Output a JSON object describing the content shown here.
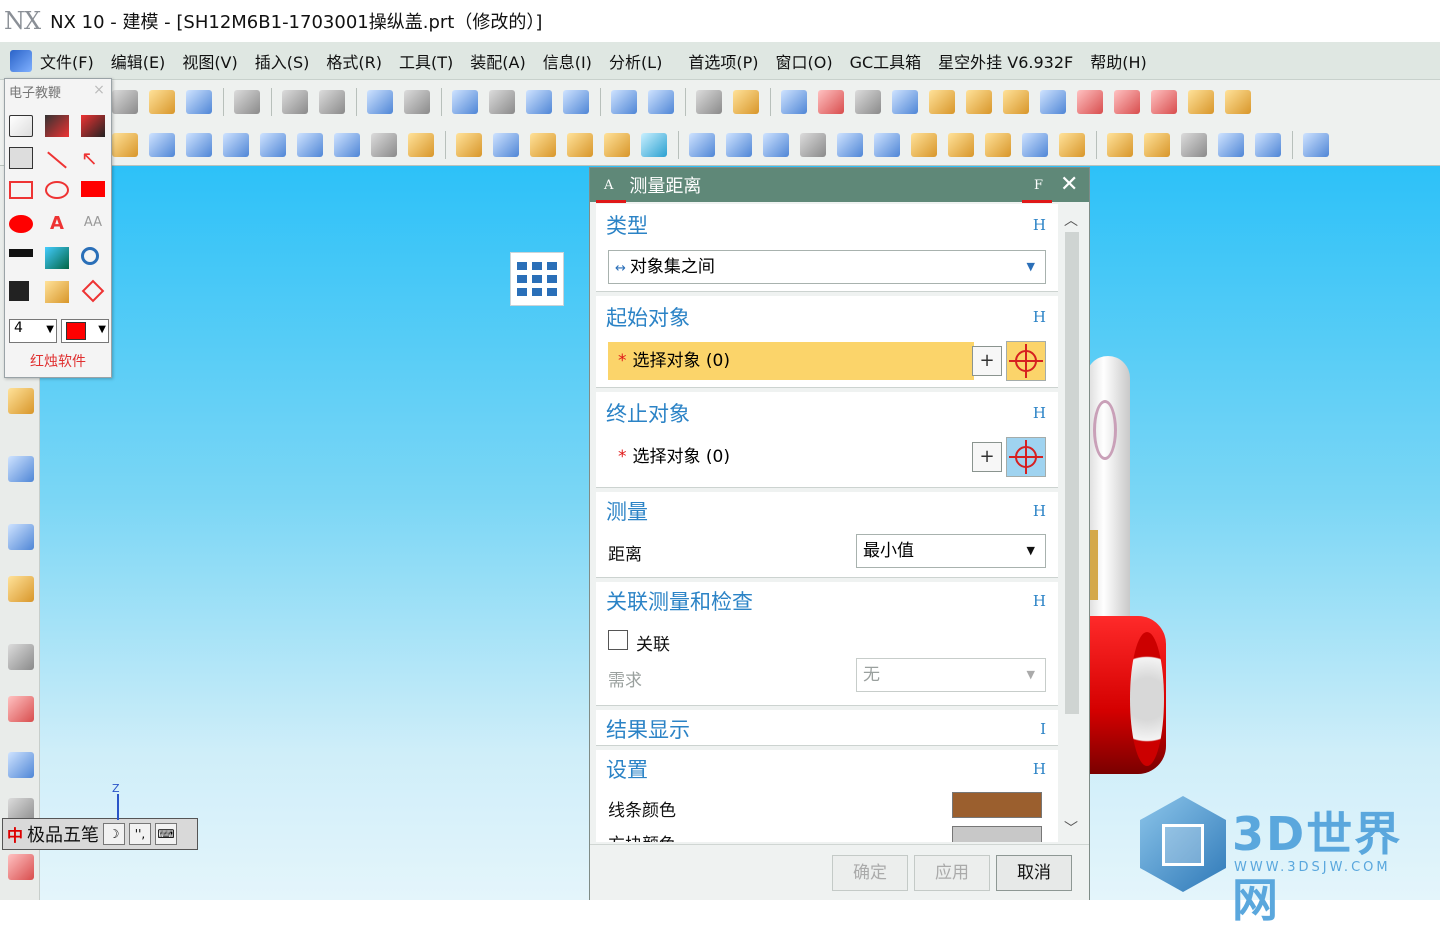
{
  "window": {
    "logo": "NX",
    "title": "NX 10 - 建模 - [SH12M6B1-1703001操纵盖.prt（修改的）]"
  },
  "menubar": {
    "items": [
      "文件(F)",
      "编辑(E)",
      "视图(V)",
      "插入(S)",
      "格式(R)",
      "工具(T)",
      "装配(A)",
      "信息(I)",
      "分析(L)",
      "首选项(P)",
      "窗口(O)",
      "GC工具箱",
      "星空外挂 V6.932F",
      "帮助(H)"
    ]
  },
  "float_toolbox": {
    "search_placeholder": "电子教鞭",
    "close_glyph": "×",
    "line_width": "4",
    "color": "#ff0000",
    "brand": "红烛软件",
    "text_tool": "A",
    "font_tool": "AA"
  },
  "ime": {
    "logo": "中",
    "name": "极品五笔",
    "moon": "☽",
    "punct": "'', ",
    "keyboard": "⌨"
  },
  "axis": {
    "z_label": "Z"
  },
  "dialog": {
    "title": "测量距离",
    "left_marker": "A",
    "right_marker": "F",
    "close": "✕",
    "sections": {
      "type": {
        "title": "类型",
        "hotkey": "H",
        "value": "对象集之间"
      },
      "start": {
        "title": "起始对象",
        "hotkey": "H",
        "select_label": "选择对象 (0)"
      },
      "end": {
        "title": "终止对象",
        "hotkey": "H",
        "select_label": "选择对象 (0)"
      },
      "measure": {
        "title": "测量",
        "hotkey": "H",
        "distance_label": "距离",
        "distance_value": "最小值"
      },
      "assoc": {
        "title": "关联测量和检查",
        "hotkey": "H",
        "assoc_label": "关联",
        "assoc_checked": false,
        "req_label": "需求",
        "req_value": "无"
      },
      "result": {
        "title": "结果显示",
        "hotkey": "I"
      },
      "settings": {
        "title": "设置",
        "hotkey": "H",
        "line_color_label": "线条颜色",
        "line_color": "#9b5f2e",
        "block_color_label": "方块颜色",
        "block_color": "#c8c8c8"
      }
    },
    "buttons": {
      "ok": "确定",
      "apply": "应用",
      "cancel": "取消"
    },
    "highlight_color": "#fbd46a"
  },
  "watermark": {
    "text": "3D世界网",
    "url": "WWW.3DSJW.COM"
  }
}
